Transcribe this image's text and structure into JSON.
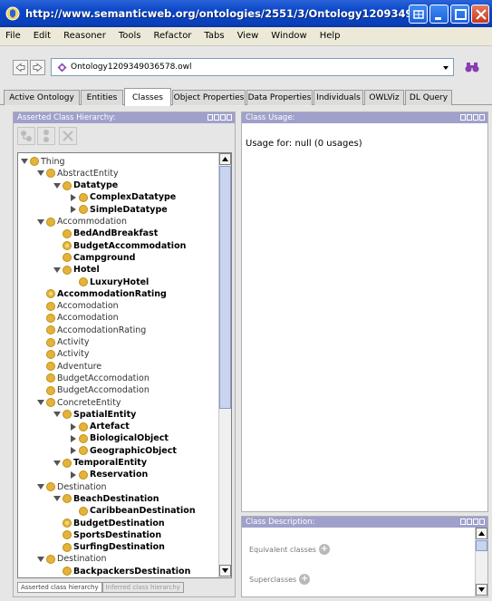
{
  "window": {
    "title": "http://www.semanticweb.org/ontologies/2551/3/Ontology1209349036578.owl - [D:"
  },
  "menu": [
    "File",
    "Edit",
    "Reasoner",
    "Tools",
    "Refactor",
    "Tabs",
    "View",
    "Window",
    "Help"
  ],
  "address": {
    "ontology": "Ontology1209349036578.owl"
  },
  "tabs": [
    {
      "label": "Active Ontology",
      "active": false
    },
    {
      "label": "Entities",
      "active": false
    },
    {
      "label": "Classes",
      "active": true
    },
    {
      "label": "Object Properties",
      "active": false
    },
    {
      "label": "Data Properties",
      "active": false
    },
    {
      "label": "Individuals",
      "active": false
    },
    {
      "label": "OWLViz",
      "active": false
    },
    {
      "label": "DL Query",
      "active": false
    }
  ],
  "hierarchy": {
    "title": "Asserted Class Hierarchy:",
    "view_tabs": [
      "Asserted class hierarchy",
      "Inferred class hierarchy"
    ],
    "tree": [
      {
        "label": "Thing",
        "level": 0,
        "expanded": true,
        "bold": false
      },
      {
        "label": "AbstractEntity",
        "level": 1,
        "expanded": true,
        "bold": false
      },
      {
        "label": "Datatype",
        "level": 2,
        "expanded": true,
        "bold": true
      },
      {
        "label": "ComplexDatatype",
        "level": 3,
        "collapsed": true,
        "bold": true
      },
      {
        "label": "SimpleDatatype",
        "level": 3,
        "collapsed": true,
        "bold": true
      },
      {
        "label": "Accommodation",
        "level": 1,
        "expanded": true,
        "bold": false
      },
      {
        "label": "BedAndBreakfast",
        "level": 2,
        "bold": true
      },
      {
        "label": "BudgetAccommodation",
        "level": 2,
        "bold": true,
        "ring": true
      },
      {
        "label": "Campground",
        "level": 2,
        "bold": true
      },
      {
        "label": "Hotel",
        "level": 2,
        "expanded": true,
        "bold": true
      },
      {
        "label": "LuxuryHotel",
        "level": 3,
        "bold": true
      },
      {
        "label": "AccommodationRating",
        "level": 1,
        "bold": true,
        "ring": true
      },
      {
        "label": "Accomodation",
        "level": 1,
        "bold": false
      },
      {
        "label": "Accomodation",
        "level": 1,
        "bold": false
      },
      {
        "label": "AccomodationRating",
        "level": 1,
        "bold": false
      },
      {
        "label": "Activity",
        "level": 1,
        "bold": false
      },
      {
        "label": "Activity",
        "level": 1,
        "bold": false
      },
      {
        "label": "Adventure",
        "level": 1,
        "bold": false
      },
      {
        "label": "BudgetAccomodation",
        "level": 1,
        "bold": false
      },
      {
        "label": "BudgetAccomodation",
        "level": 1,
        "bold": false
      },
      {
        "label": "ConcreteEntity",
        "level": 1,
        "expanded": true,
        "bold": false
      },
      {
        "label": "SpatialEntity",
        "level": 2,
        "expanded": true,
        "bold": true
      },
      {
        "label": "Artefact",
        "level": 3,
        "collapsed": true,
        "bold": true
      },
      {
        "label": "BiologicalObject",
        "level": 3,
        "collapsed": true,
        "bold": true
      },
      {
        "label": "GeographicObject",
        "level": 3,
        "collapsed": true,
        "bold": true
      },
      {
        "label": "TemporalEntity",
        "level": 2,
        "expanded": true,
        "bold": true
      },
      {
        "label": "Reservation",
        "level": 3,
        "collapsed": true,
        "bold": true
      },
      {
        "label": "Destination",
        "level": 1,
        "expanded": true,
        "bold": false
      },
      {
        "label": "BeachDestination",
        "level": 2,
        "expanded": true,
        "bold": true
      },
      {
        "label": "CaribbeanDestination",
        "level": 3,
        "bold": true
      },
      {
        "label": "BudgetDestination",
        "level": 2,
        "bold": true,
        "ring": true
      },
      {
        "label": "SportsDestination",
        "level": 2,
        "bold": true
      },
      {
        "label": "SurfingDestination",
        "level": 2,
        "bold": true
      },
      {
        "label": "Destination",
        "level": 1,
        "expanded": true,
        "bold": false
      },
      {
        "label": "BackpackersDestination",
        "level": 2,
        "bold": true
      }
    ]
  },
  "usage": {
    "title": "Class Usage:",
    "text": "Usage for: null (0 usages)"
  },
  "description": {
    "title": "Class Description:",
    "equivalent": "Equivalent classes",
    "superclasses": "Superclasses"
  }
}
